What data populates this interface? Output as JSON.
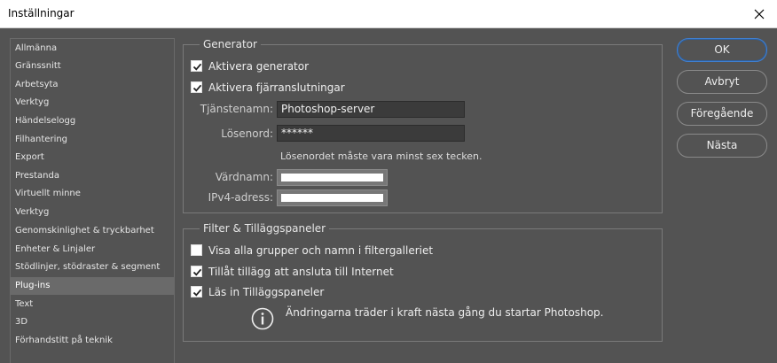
{
  "window": {
    "title": "Inställningar",
    "close_icon": "close-icon"
  },
  "sidebar": {
    "items": [
      {
        "label": "Allmänna"
      },
      {
        "label": "Gränssnitt"
      },
      {
        "label": "Arbetsyta"
      },
      {
        "label": "Verktyg"
      },
      {
        "label": "Händelselogg"
      },
      {
        "label": "Filhantering"
      },
      {
        "label": "Export"
      },
      {
        "label": "Prestanda"
      },
      {
        "label": "Virtuellt minne"
      },
      {
        "label": "Verktyg"
      },
      {
        "label": "Genomskinlighet & tryckbarhet"
      },
      {
        "label": "Enheter & Linjaler"
      },
      {
        "label": "Stödlinjer, stödraster & segment"
      },
      {
        "label": "Plug-ins"
      },
      {
        "label": "Text"
      },
      {
        "label": "3D"
      },
      {
        "label": "Förhandstitt på teknik"
      }
    ],
    "selected_index": 13
  },
  "generator": {
    "legend": "Generator",
    "enable_generator": {
      "label": "Aktivera generator",
      "checked": true
    },
    "enable_remote": {
      "label": "Aktivera fjärranslutningar",
      "checked": true
    },
    "service_name": {
      "label": "Tjänstenamn:",
      "value": "Photoshop-server"
    },
    "password": {
      "label": "Lösenord:",
      "value": "******"
    },
    "password_hint": "Lösenordet måste vara minst sex tecken.",
    "hostname": {
      "label": "Värdnamn:",
      "value": ""
    },
    "ipv4": {
      "label": "IPv4-adress:",
      "value": ""
    }
  },
  "filters": {
    "legend": "Filter & Tilläggspaneler",
    "show_all_groups": {
      "label": "Visa alla grupper och namn i filtergalleriet",
      "checked": false
    },
    "allow_extensions": {
      "label": "Tillåt tillägg att ansluta till Internet",
      "checked": true
    },
    "load_panels": {
      "label": "Läs in Tilläggspaneler",
      "checked": true
    },
    "info_icon": "info-icon",
    "info_text": "Ändringarna träder i kraft nästa gång du startar Photoshop."
  },
  "buttons": {
    "ok": "OK",
    "cancel": "Avbryt",
    "previous": "Föregående",
    "next": "Nästa"
  },
  "colors": {
    "background": "#535353",
    "selected_item": "#6a6a6a",
    "primary_border": "#3f7fd0"
  }
}
